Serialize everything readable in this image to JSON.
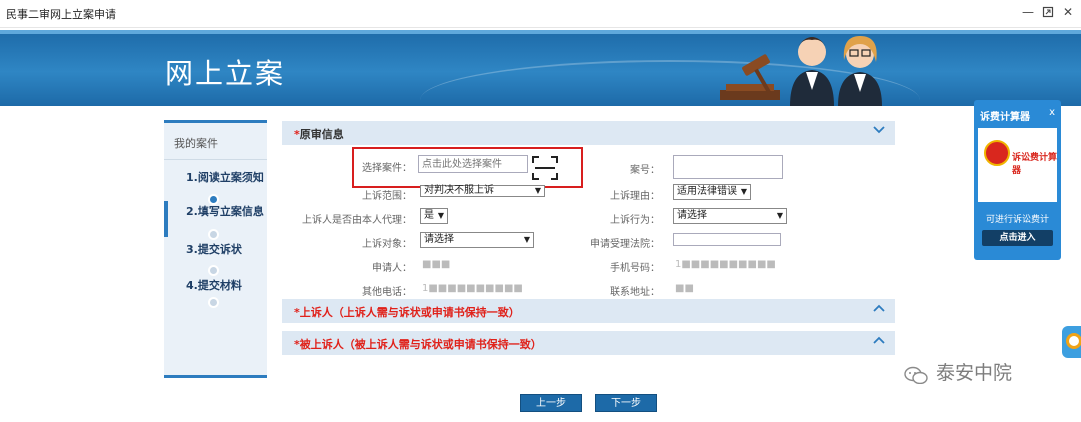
{
  "window": {
    "title": "民事二审网上立案申请"
  },
  "banner": {
    "title": "网上立案"
  },
  "leftnav": {
    "heading": "我的案件",
    "items": [
      {
        "label": "1.阅读立案须知"
      },
      {
        "label": "2.填写立案信息"
      },
      {
        "label": "3.提交诉状"
      },
      {
        "label": "4.提交材料"
      }
    ]
  },
  "sections": {
    "original": {
      "star": "*",
      "label": "原审信息"
    },
    "appellant": {
      "star": "*",
      "label": "上诉人（上诉人需与诉状或申请书保持一致）"
    },
    "appellee": {
      "star": "*",
      "label": "被上诉人（被上诉人需与诉状或申请书保持一致）"
    }
  },
  "form": {
    "select_case_label": "选择案件：",
    "select_case_placeholder": "点击此处选择案件",
    "case_no_label": "案号：",
    "appeal_scope_label": "上诉范围：",
    "appeal_scope_value": "对判决不服上诉",
    "appeal_reason_label": "上诉理由：",
    "appeal_reason_value": "适用法律错误",
    "self_agent_label": "上诉人是否由本人代理：",
    "self_agent_value": "是",
    "appeal_action_label": "上诉行为：",
    "appeal_action_value": "请选择",
    "appeal_target_label": "上诉对象：",
    "appeal_target_value": "请选择",
    "court_label": "申请受理法院：",
    "applicant_label": "申请人：",
    "applicant_value": "■■■",
    "phone_label": "手机号码：",
    "phone_value": "1■■■■■■■■■■",
    "other_phone_label": "其他电话：",
    "other_phone_value": "1■■■■■■■■■■",
    "address_label": "联系地址：",
    "address_value": "■■"
  },
  "buttons": {
    "prev": "上一步",
    "next": "下一步"
  },
  "calculator": {
    "header": "诉费计算器",
    "close": "x",
    "image_text": "诉讼费计算器",
    "caption": "可进行诉讼费计",
    "enter": "点击进入"
  },
  "watermark": {
    "text": "泰安中院"
  },
  "colors": {
    "banner_blue": "#1d6aa8",
    "accent": "#2d7cbf",
    "required_red": "#e0211a",
    "highlight_box": "#d81e1e"
  }
}
